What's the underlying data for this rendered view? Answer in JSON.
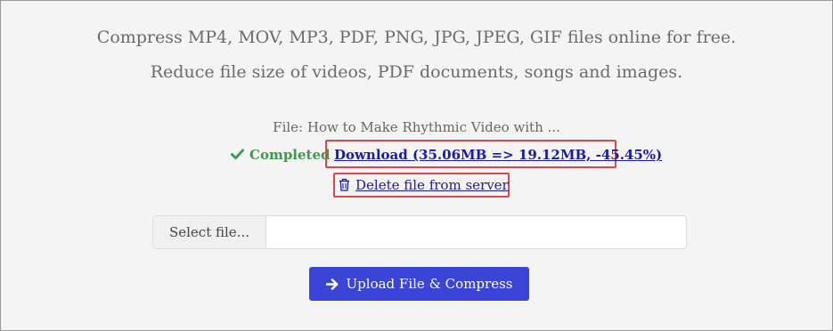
{
  "header": {
    "line1": "Compress MP4, MOV, MP3, PDF, PNG, JPG, JPEG, GIF files online for free.",
    "line2": "Reduce file size of videos, PDF documents, songs and images."
  },
  "result": {
    "file_label": "File: How to Make Rhythmic Video with ...",
    "status_text": "Completed",
    "status_color": "#3a9b4a",
    "download_label": "Download (35.06MB => 19.12MB, -45.45%)",
    "delete_label": "Delete file from server",
    "highlight_color": "#e0474c"
  },
  "form": {
    "select_file_label": "Select file...",
    "selected_file": "",
    "upload_label": "Upload File & Compress",
    "upload_color": "#3a44d6"
  }
}
